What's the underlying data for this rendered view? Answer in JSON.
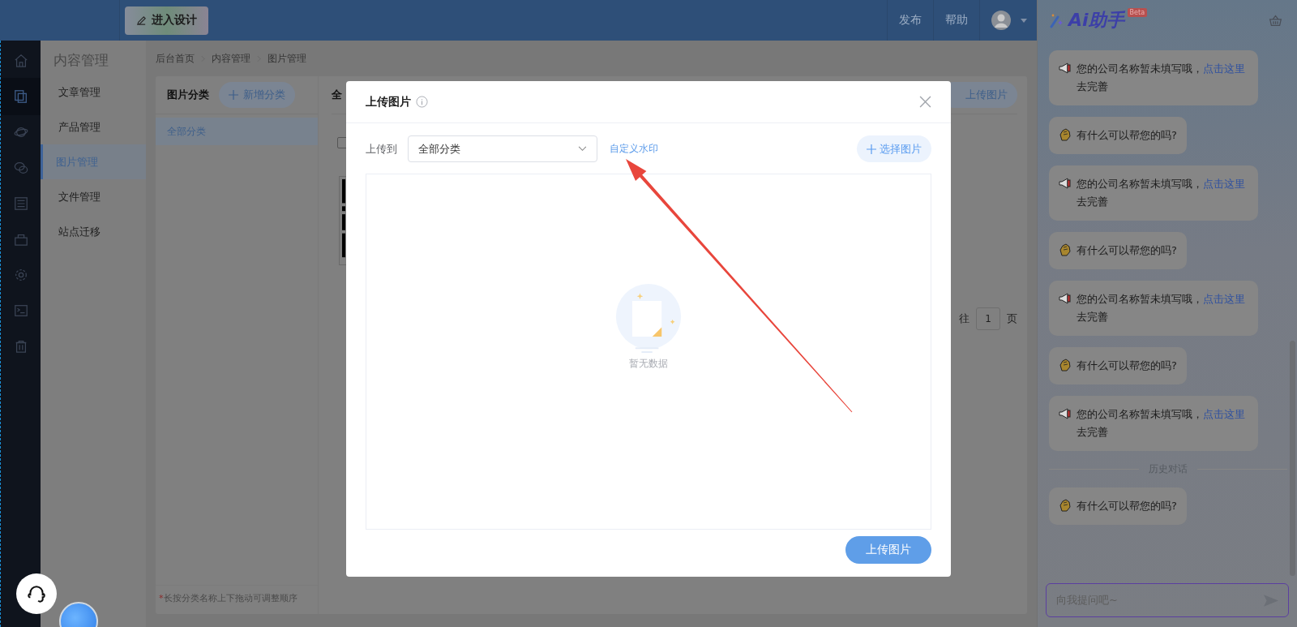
{
  "topbar": {
    "design_button": "进入设计",
    "links": [
      "发布",
      "帮助"
    ]
  },
  "content_nav": {
    "title": "内容管理",
    "items": [
      {
        "label": "文章管理",
        "selected": false
      },
      {
        "label": "产品管理",
        "selected": false
      },
      {
        "label": "图片管理",
        "selected": true
      },
      {
        "label": "文件管理",
        "selected": false
      },
      {
        "label": "站点迁移",
        "selected": false
      }
    ]
  },
  "breadcrumb": [
    "后台首页",
    "内容管理",
    "图片管理"
  ],
  "category_panel": {
    "title": "图片分类",
    "add_button": "新增分类",
    "categories": [
      {
        "label": "全部分类",
        "selected": true
      }
    ],
    "hint_mark": "*",
    "hint": "长按分类名称上下拖动可调整顺序"
  },
  "image_panel": {
    "heading": "全",
    "select_all_checked": false,
    "upload_button": "上传图片",
    "pager_prefix": "往",
    "pager_page": "1",
    "pager_suffix": "页"
  },
  "dialog": {
    "title": "上传图片",
    "upload_to_label": "上传到",
    "category_select": "全部分类",
    "watermark_link": "自定义水印",
    "choose_button": "选择图片",
    "empty_text": "暂无数据",
    "submit_button": "上传图片"
  },
  "assistant": {
    "title": "Ai助手",
    "badge": "Beta",
    "messages": [
      {
        "kind": "notice",
        "text": "您的公司名称暂未填写哦，",
        "link": "点击这里",
        "suffix": "去完善"
      },
      {
        "kind": "greeting",
        "text": "有什么可以帮您的吗?"
      },
      {
        "kind": "notice",
        "text": "您的公司名称暂未填写哦，",
        "link": "点击这里",
        "suffix": "去完善"
      },
      {
        "kind": "greeting",
        "text": "有什么可以帮您的吗?"
      },
      {
        "kind": "notice",
        "text": "您的公司名称暂未填写哦，",
        "link": "点击这里",
        "suffix": "去完善"
      },
      {
        "kind": "greeting",
        "text": "有什么可以帮您的吗?"
      },
      {
        "kind": "notice",
        "text": "您的公司名称暂未填写哦，",
        "link": "点击这里",
        "suffix": "去完善"
      },
      {
        "kind": "divider",
        "text": "历史对话"
      },
      {
        "kind": "greeting",
        "text": "有什么可以帮您的吗?"
      }
    ],
    "input_placeholder": "向我提问吧~"
  }
}
